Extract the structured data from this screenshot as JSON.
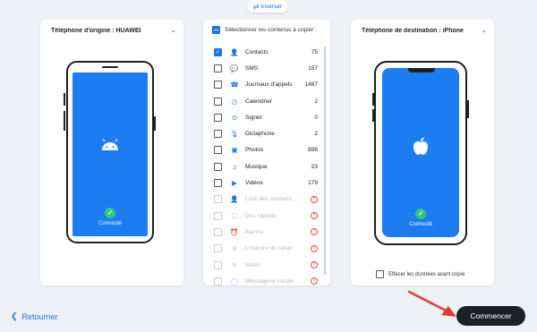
{
  "swap": {
    "label": "Inverser",
    "icon": "swap-arrows-icon"
  },
  "source": {
    "title": "Téléphone d'origine : HUAWEI",
    "status": "Connecté",
    "logo": "android-icon"
  },
  "destination": {
    "title": "Téléphone de destination : iPhone",
    "status": "Connecté",
    "logo": "apple-icon",
    "erase_label": "Effacer les données avant copie"
  },
  "content": {
    "select_all_label": "Sélectionner les contenus à copier :",
    "items": [
      {
        "label": "Contacts",
        "count": "75",
        "icon": "contacts-icon",
        "state": "checked"
      },
      {
        "label": "SMS",
        "count": "157",
        "icon": "sms-icon",
        "state": "unchecked"
      },
      {
        "label": "Journaux d'appels",
        "count": "1487",
        "icon": "call-log-icon",
        "state": "unchecked"
      },
      {
        "label": "Calendrier",
        "count": "2",
        "icon": "calendar-icon",
        "state": "unchecked"
      },
      {
        "label": "Signet",
        "count": "0",
        "icon": "bookmark-icon",
        "state": "unchecked"
      },
      {
        "label": "Dictaphone",
        "count": "2",
        "icon": "microphone-icon",
        "state": "unchecked"
      },
      {
        "label": "Photos",
        "count": "898",
        "icon": "photo-icon",
        "state": "unchecked"
      },
      {
        "label": "Musique",
        "count": "23",
        "icon": "music-icon",
        "state": "unchecked"
      },
      {
        "label": "Vidéos",
        "count": "179",
        "icon": "video-icon",
        "state": "unchecked"
      },
      {
        "label": "Liste des contacts ...",
        "count": "!",
        "icon": "contacts-list-icon",
        "state": "disabled"
      },
      {
        "label": "Des rappels",
        "count": "!",
        "icon": "reminder-icon",
        "state": "disabled"
      },
      {
        "label": "Alarme",
        "count": "!",
        "icon": "alarm-icon",
        "state": "disabled"
      },
      {
        "label": "L'histoire du safari",
        "count": "!",
        "icon": "safari-icon",
        "state": "disabled"
      },
      {
        "label": "Notes",
        "count": "!",
        "icon": "notes-icon",
        "state": "disabled"
      },
      {
        "label": "Messagerie vocale",
        "count": "!",
        "icon": "voicemail-icon",
        "state": "disabled"
      }
    ]
  },
  "footer": {
    "back_label": "Retourner",
    "start_label": "Commencer"
  },
  "colors": {
    "accent": "#1a73e8",
    "phone_screen": "#1c7cf2",
    "success": "#2fc97c",
    "warning": "#e84b4b",
    "button_dark": "#1c2029"
  }
}
